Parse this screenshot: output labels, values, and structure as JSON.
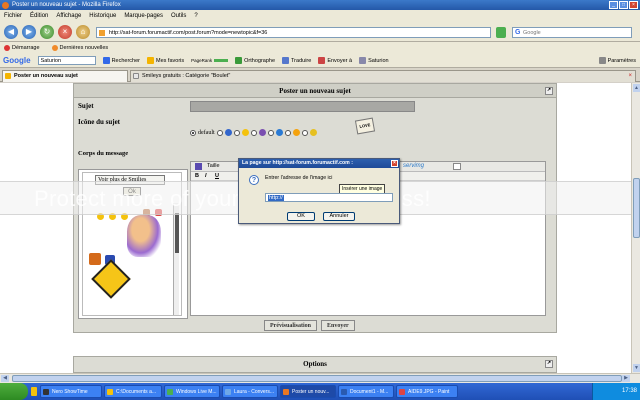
{
  "window": {
    "title": "Poster un nouveau sujet - Mozilla Firefox"
  },
  "menu": {
    "items": [
      "Fichier",
      "Édition",
      "Affichage",
      "Historique",
      "Marque-pages",
      "Outils",
      "?"
    ]
  },
  "navbar": {
    "url": "http://sat-forum.forumactif.com/post.forum?mode=newtopic&f=36",
    "search_placeholder": "Google"
  },
  "bookmarks": {
    "items": [
      "Démarrage",
      "Dernières nouvelles"
    ]
  },
  "google_toolbar": {
    "logo": "Google",
    "profile": "Saturion",
    "items": [
      "Rechercher",
      "Mes favoris",
      "PageRank",
      "Orthographe",
      "Traduire",
      "Envoyer à",
      "Saturion"
    ],
    "settings": "Paramètres"
  },
  "tabs": [
    {
      "label": "Poster un nouveau sujet"
    },
    {
      "label": "Smileys gratuits : Catégorie \"Boulet\""
    }
  ],
  "form": {
    "header": "Poster un nouveau sujet",
    "subject_label": "Sujet",
    "icon_label": "Icône du sujet",
    "icon_default": "default",
    "love_sign": "LOVE",
    "body_label": "Corps du message",
    "smilies_select": "Voir plus de Smilies",
    "smilies_ok": "Ok",
    "editor_font": "Taille",
    "editor_bold": "B",
    "editor_italic": "I",
    "editor_underline": "U",
    "servimg": "servimg",
    "preview_button": "Prévisualisation",
    "submit_button": "Envoyer",
    "options_header": "Options"
  },
  "dialog": {
    "title": "La page sur http://sat-forum.forumactif.com :",
    "prompt": "Entrer l'adresse de l'image ici",
    "tooltip": "Insérer une image",
    "input_value": "http://",
    "ok": "OK",
    "cancel": "Annuler"
  },
  "watermark": "Protect more of your memories for less!",
  "taskbar": {
    "items": [
      "Nero ShowTime",
      "C:\\Documents a...",
      "Windows Live M...",
      "Laura - Convers...",
      "Poster un nouv...",
      "Document1 - M...",
      "AIDE9.JPG - Paint"
    ],
    "clock": "17:38"
  }
}
